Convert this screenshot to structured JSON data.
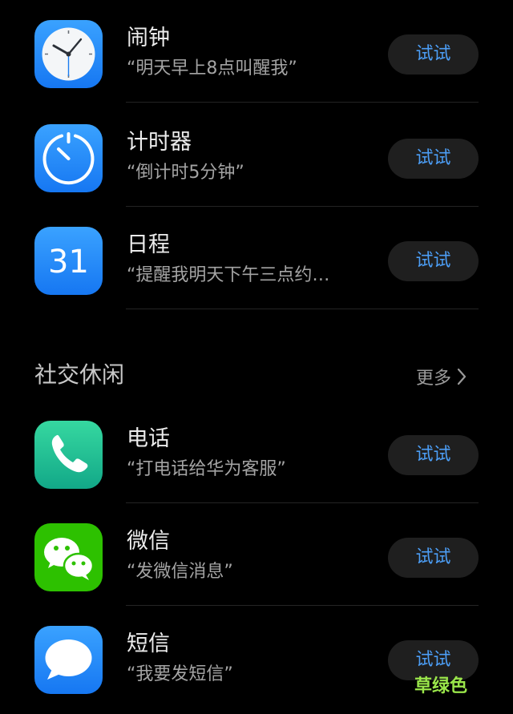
{
  "colors": {
    "background": "#000000",
    "button_bg": "#1f1f1f",
    "button_text": "#4c9ef6",
    "title_text": "#ececec",
    "subtitle_text": "#a4a4a4",
    "watermark": "#9ae64a"
  },
  "tools": [
    {
      "title": "闹钟",
      "example": "“明天早上8点叫醒我”",
      "button": "试试",
      "icon": "clock-icon"
    },
    {
      "title": "计时器",
      "example": "“倒计时5分钟”",
      "button": "试试",
      "icon": "timer-icon"
    },
    {
      "title": "日程",
      "example": "“提醒我明天下午三点约…",
      "button": "试试",
      "icon": "calendar-icon",
      "icon_text": "31"
    }
  ],
  "social_section": {
    "title": "社交休闲",
    "more_label": "更多"
  },
  "social": [
    {
      "title": "电话",
      "example": "“打电话给华为客服”",
      "button": "试试",
      "icon": "phone-icon"
    },
    {
      "title": "微信",
      "example": "“发微信消息”",
      "button": "试试",
      "icon": "wechat-icon"
    },
    {
      "title": "短信",
      "example": "“我要发短信”",
      "button": "试试",
      "icon": "message-icon"
    }
  ],
  "watermark": "草绿色"
}
